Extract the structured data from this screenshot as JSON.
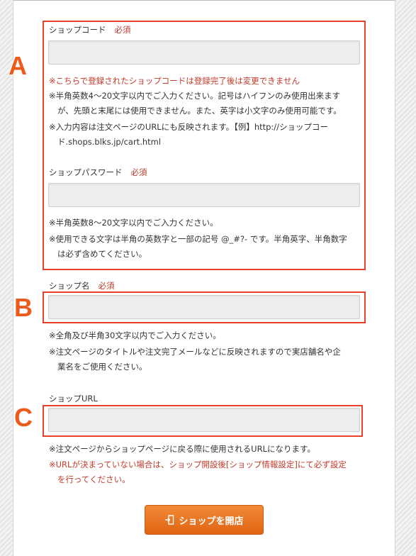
{
  "shop_code": {
    "label": "ショップコード",
    "required": "必須",
    "value": "",
    "notes": [
      {
        "text": "※こちらで登録されたショップコードは登録完了後は変更できません",
        "red": true
      },
      {
        "line1": "※半角英数4〜20文字以内でご入力ください。記号はハイフンのみ使用出来ます",
        "line2": "が、先頭と末尾には使用できません。また、英字は小文字のみ使用可能です。"
      },
      {
        "line1": "※入力内容は注文ページのURLにも反映されます。【例】http://ショップコー",
        "line2": "ド.shops.blks.jp/cart.html"
      }
    ]
  },
  "shop_password": {
    "label": "ショップパスワード",
    "required": "必須",
    "value": "",
    "notes": [
      {
        "text": "※半角英数8〜20文字以内でご入力ください。"
      },
      {
        "line1": "※使用できる文字は半角の英数字と一部の記号 @_#?- です。半角英字、半角数字",
        "line2": "は必ず含めてください。"
      }
    ]
  },
  "shop_name": {
    "label": "ショップ名",
    "required": "必須",
    "value": "",
    "notes": [
      {
        "text": "※全角及び半角30文字以内でご入力ください。"
      },
      {
        "line1": "※注文ページのタイトルや注文完了メールなどに反映されますので実店舗名や企",
        "line2": "業名をご使用ください。"
      }
    ]
  },
  "shop_url": {
    "label": "ショップURL",
    "value": "",
    "notes": [
      {
        "text": "※注文ページからショップページに戻る際に使用されるURLになります。"
      },
      {
        "line1": "※URLが決まっていない場合は、ショップ開設後[ショップ情報設定]にて必ず設定",
        "line2": "を行ってください。",
        "red": true
      }
    ]
  },
  "markers": {
    "a": "A",
    "b": "B",
    "c": "C"
  },
  "submit": {
    "label": "ショップを開店",
    "icon": "door-enter-icon"
  },
  "colors": {
    "accent": "#e06414",
    "required": "#c23a2a",
    "highlight": "#e8412b"
  }
}
